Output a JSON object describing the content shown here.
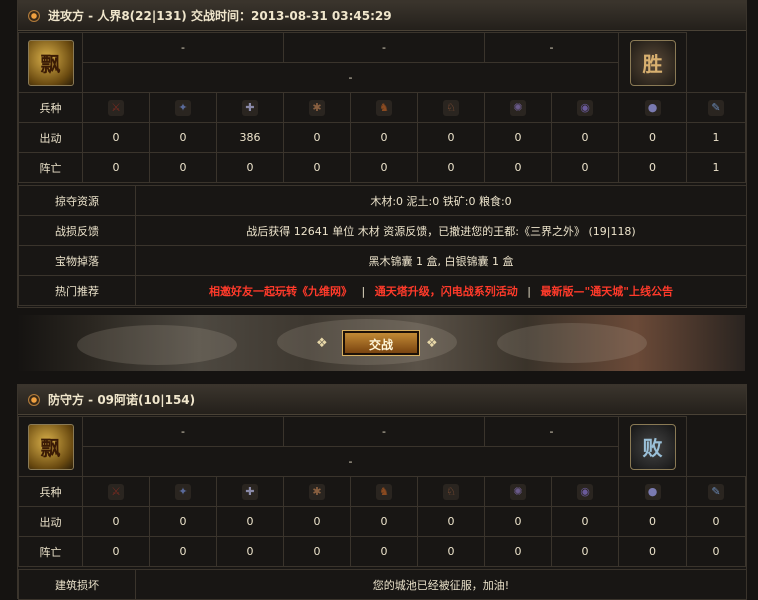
{
  "attack": {
    "title": "进攻方 - 人界8(22|131) 交战时间：2013-08-31 03:45:29",
    "slots_top": [
      "-",
      "-",
      "-"
    ],
    "slot_bottom": "-",
    "seal_left": "飘",
    "seal_right": "胜",
    "row_labels": {
      "units": "兵种",
      "sent": "出动",
      "lost": "阵亡"
    },
    "sent": [
      "0",
      "0",
      "386",
      "0",
      "0",
      "0",
      "0",
      "0",
      "0",
      "1"
    ],
    "lost": [
      "0",
      "0",
      "0",
      "0",
      "0",
      "0",
      "0",
      "0",
      "0",
      "1"
    ],
    "plunder_label": "掠夺资源",
    "plunder_value": "木材:0 泥土:0 铁矿:0 粮食:0",
    "feedback_label": "战损反馈",
    "feedback_value": "战后获得 12641 单位 木材 资源反馈，已撤进您的王都:《三界之外》 (19|118)",
    "drop_label": "宝物掉落",
    "drop_value": "黑木锦囊 1 盒, 白银锦囊 1 盒",
    "hot_label": "热门推荐",
    "hot_links": [
      "相邀好友一起玩转《九维网》",
      "通天塔升级，闪电战系列活动",
      "最新版—\"通天城\"上线公告"
    ],
    "hot_sep": "|"
  },
  "battle_button": "交战",
  "defense": {
    "title": "防守方 - 09阿诺(10|154)",
    "slots_top": [
      "-",
      "-",
      "-"
    ],
    "slot_bottom": "-",
    "seal_left": "飘",
    "seal_right": "败",
    "row_labels": {
      "units": "兵种",
      "sent": "出动",
      "lost": "阵亡"
    },
    "sent": [
      "0",
      "0",
      "0",
      "0",
      "0",
      "0",
      "0",
      "0",
      "0",
      "0"
    ],
    "lost": [
      "0",
      "0",
      "0",
      "0",
      "0",
      "0",
      "0",
      "0",
      "0",
      "0"
    ],
    "building_label": "建筑损坏",
    "building_value": "您的城池已经被征服，加油!"
  },
  "unit_icons": [
    {
      "name": "spearman-icon",
      "glyph": "⚔",
      "color": "#7a2a20"
    },
    {
      "name": "shield-icon",
      "glyph": "✦",
      "color": "#5a6a9a"
    },
    {
      "name": "sword-icon",
      "glyph": "✚",
      "color": "#8a8aa8"
    },
    {
      "name": "axe-icon",
      "glyph": "✱",
      "color": "#8a6040"
    },
    {
      "name": "horse-icon",
      "glyph": "♞",
      "color": "#8a4a20"
    },
    {
      "name": "cavalry-icon",
      "glyph": "♘",
      "color": "#9a5a3a"
    },
    {
      "name": "catapult-icon",
      "glyph": "✺",
      "color": "#6a5a8a"
    },
    {
      "name": "ram-icon",
      "glyph": "◉",
      "color": "#6a5a9a"
    },
    {
      "name": "scout-icon",
      "glyph": "●",
      "color": "#7a7ab0"
    },
    {
      "name": "settler-icon",
      "glyph": "✎",
      "color": "#6a8ab8"
    }
  ]
}
